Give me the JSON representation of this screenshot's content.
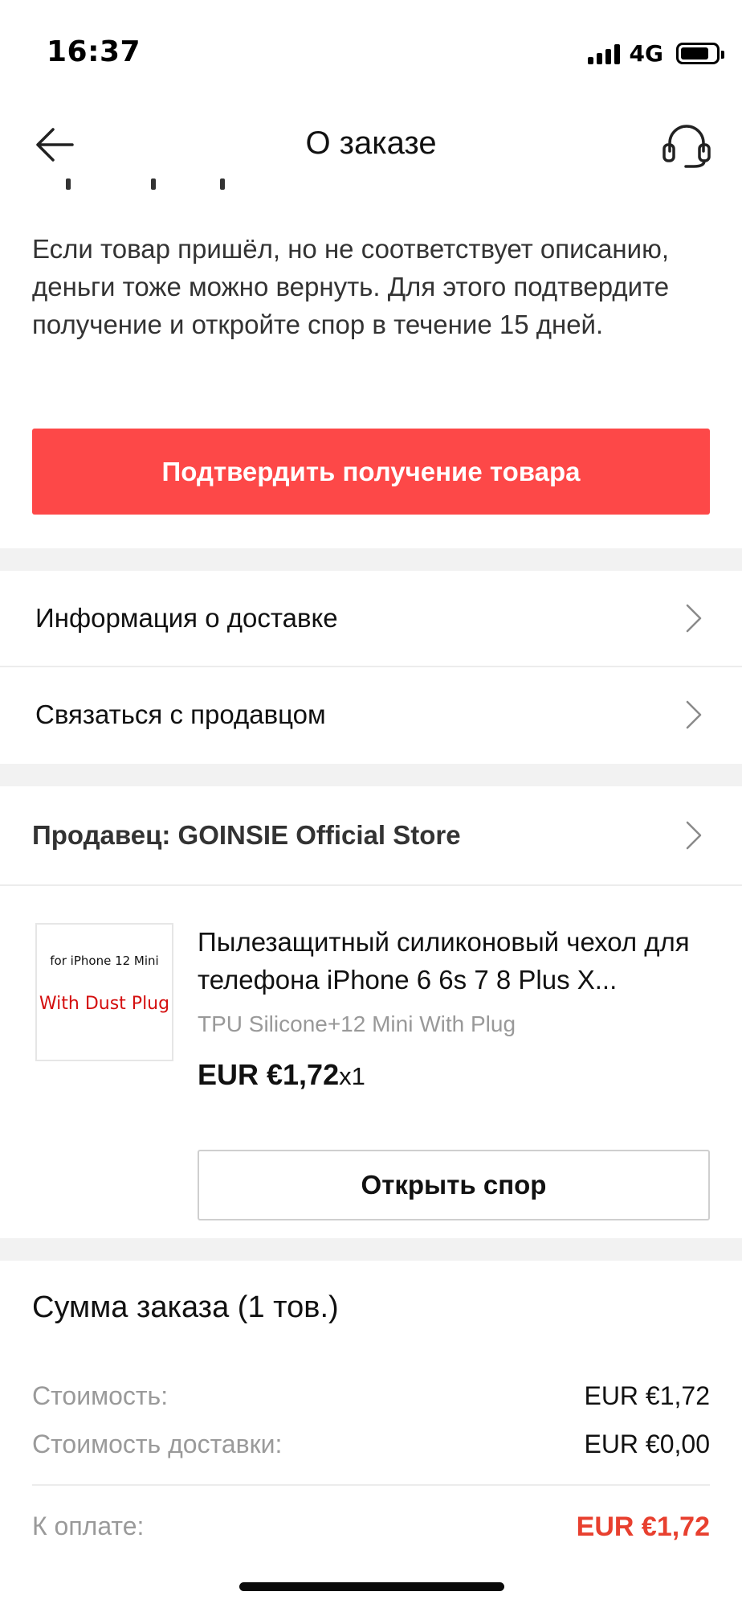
{
  "status_bar": {
    "time": "16:37",
    "network": "4G"
  },
  "nav": {
    "title": "О заказе",
    "back_icon": "arrow-left-icon",
    "support_icon": "headset-icon"
  },
  "info": {
    "text": "Если товар пришёл, но не соответствует описанию, деньги тоже можно вернуть. Для этого подтвердите получение и откройте спор в течение 15 дней."
  },
  "confirm_button": {
    "label": "Подтвердить получение товара",
    "color": "#fd4848"
  },
  "menu": {
    "delivery_info": "Информация о доставке",
    "contact_seller": "Связаться с продавцом"
  },
  "seller": {
    "label": "Продавец: GOINSIE Official Store"
  },
  "product": {
    "thumb_line1": "for iPhone 12 Mini",
    "thumb_line2": "With Dust Plug",
    "title": "Пылезащитный силиконовый чехол для телефона iPhone 6 6s 7 8 Plus X...",
    "variant": "TPU Silicone+12 Mini With Plug",
    "price": "EUR €1,72",
    "quantity": "x1",
    "dispute_button": "Открыть спор"
  },
  "summary": {
    "title": "Сумма заказа (1 тов.)",
    "cost_label": "Стоимость:",
    "cost_value": "EUR €1,72",
    "shipping_label": "Стоимость доставки:",
    "shipping_value": "EUR €0,00",
    "total_label": "К оплате:",
    "total_value": "EUR €1,72",
    "total_color": "#e8402f"
  }
}
